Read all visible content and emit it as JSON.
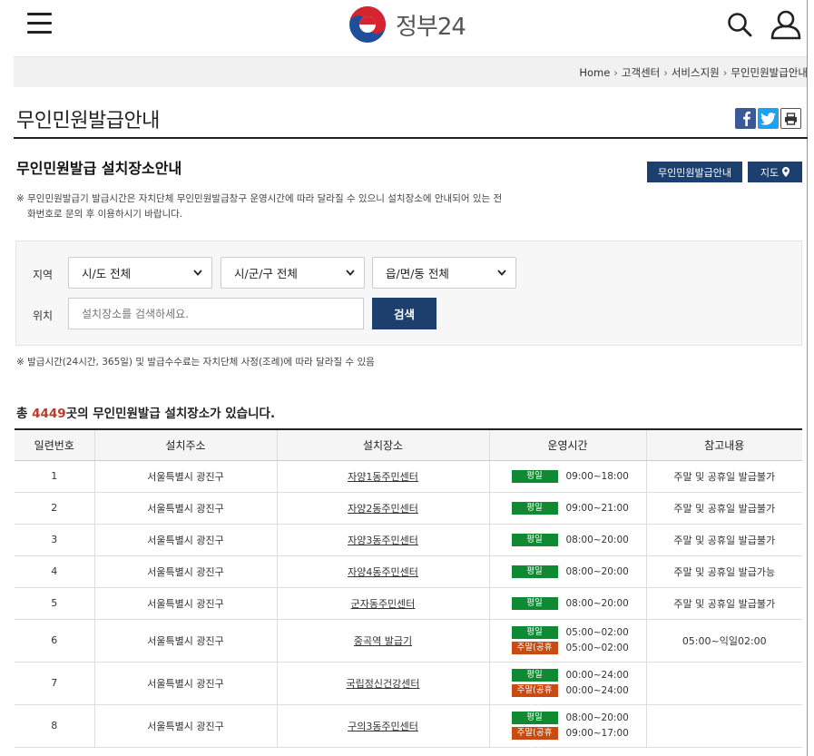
{
  "header": {
    "logo_text": "정부24"
  },
  "breadcrumb": [
    "Home",
    "고객센터",
    "서비스지원",
    "무인민원발급안내"
  ],
  "page": {
    "title": "무인민원발급안내",
    "section_title": "무인민원발급 설치장소안내",
    "guide_button": "무인민원발급안내",
    "map_button": "지도",
    "notice_line1": "※ 무인민원발급기 발급시간은 자치단체 무인민원발급창구 운영시간에 따라 달라질 수 있으니 설치장소에 안내되어 있는 전",
    "notice_line2": "화번호로 문의 후 이용하시기 바랍니다."
  },
  "search": {
    "region_label": "지역",
    "location_label": "위치",
    "sido": "시/도 전체",
    "sigungu": "시/군/구 전체",
    "eupmyeon": "읍/면/동 전체",
    "placeholder": "설치장소를 검색하세요.",
    "button": "검색"
  },
  "notice2": "※ 발급시간(24시간, 365일) 및 발급수수료는 자치단체 사정(조례)에 따라 달라질 수 있음",
  "total": {
    "prefix": "총 ",
    "count": "4449",
    "suffix": "곳의 무인민원발급 설치장소가 있습니다."
  },
  "table": {
    "headers": [
      "일련번호",
      "설치주소",
      "설치장소",
      "운영시간",
      "참고내용"
    ],
    "weekday_label": "평일",
    "weekend_label": "주말(공휴일)",
    "rows": [
      {
        "no": "1",
        "addr": "서울특별시 광진구",
        "place": "자양1동주민센터",
        "weekday": "09:00~18:00",
        "weekend": "",
        "note": "주말 및 공휴일 발급불가"
      },
      {
        "no": "2",
        "addr": "서울특별시 광진구",
        "place": "자양2동주민센터",
        "weekday": "09:00~21:00",
        "weekend": "",
        "note": "주말 및 공휴일 발급불가"
      },
      {
        "no": "3",
        "addr": "서울특별시 광진구",
        "place": "자양3동주민센터",
        "weekday": "08:00~20:00",
        "weekend": "",
        "note": "주말 및 공휴일 발급불가"
      },
      {
        "no": "4",
        "addr": "서울특별시 광진구",
        "place": "자양4동주민센터",
        "weekday": "08:00~20:00",
        "weekend": "",
        "note": "주말 및 공휴일 발급가능"
      },
      {
        "no": "5",
        "addr": "서울특별시 광진구",
        "place": "군자동주민센터",
        "weekday": "08:00~20:00",
        "weekend": "",
        "note": "주말 및 공휴일 발급불가"
      },
      {
        "no": "6",
        "addr": "서울특별시 광진구",
        "place": "중곡역 발급기",
        "weekday": "05:00~02:00",
        "weekend": "05:00~02:00",
        "note": "05:00~익일02:00"
      },
      {
        "no": "7",
        "addr": "서울특별시 광진구",
        "place": "국립정신건강센터",
        "weekday": "00:00~24:00",
        "weekend": "00:00~24:00",
        "note": ""
      },
      {
        "no": "8",
        "addr": "서울특별시 광진구",
        "place": "구의3동주민센터",
        "weekday": "08:00~20:00",
        "weekend": "09:00~17:00",
        "note": ""
      }
    ]
  }
}
